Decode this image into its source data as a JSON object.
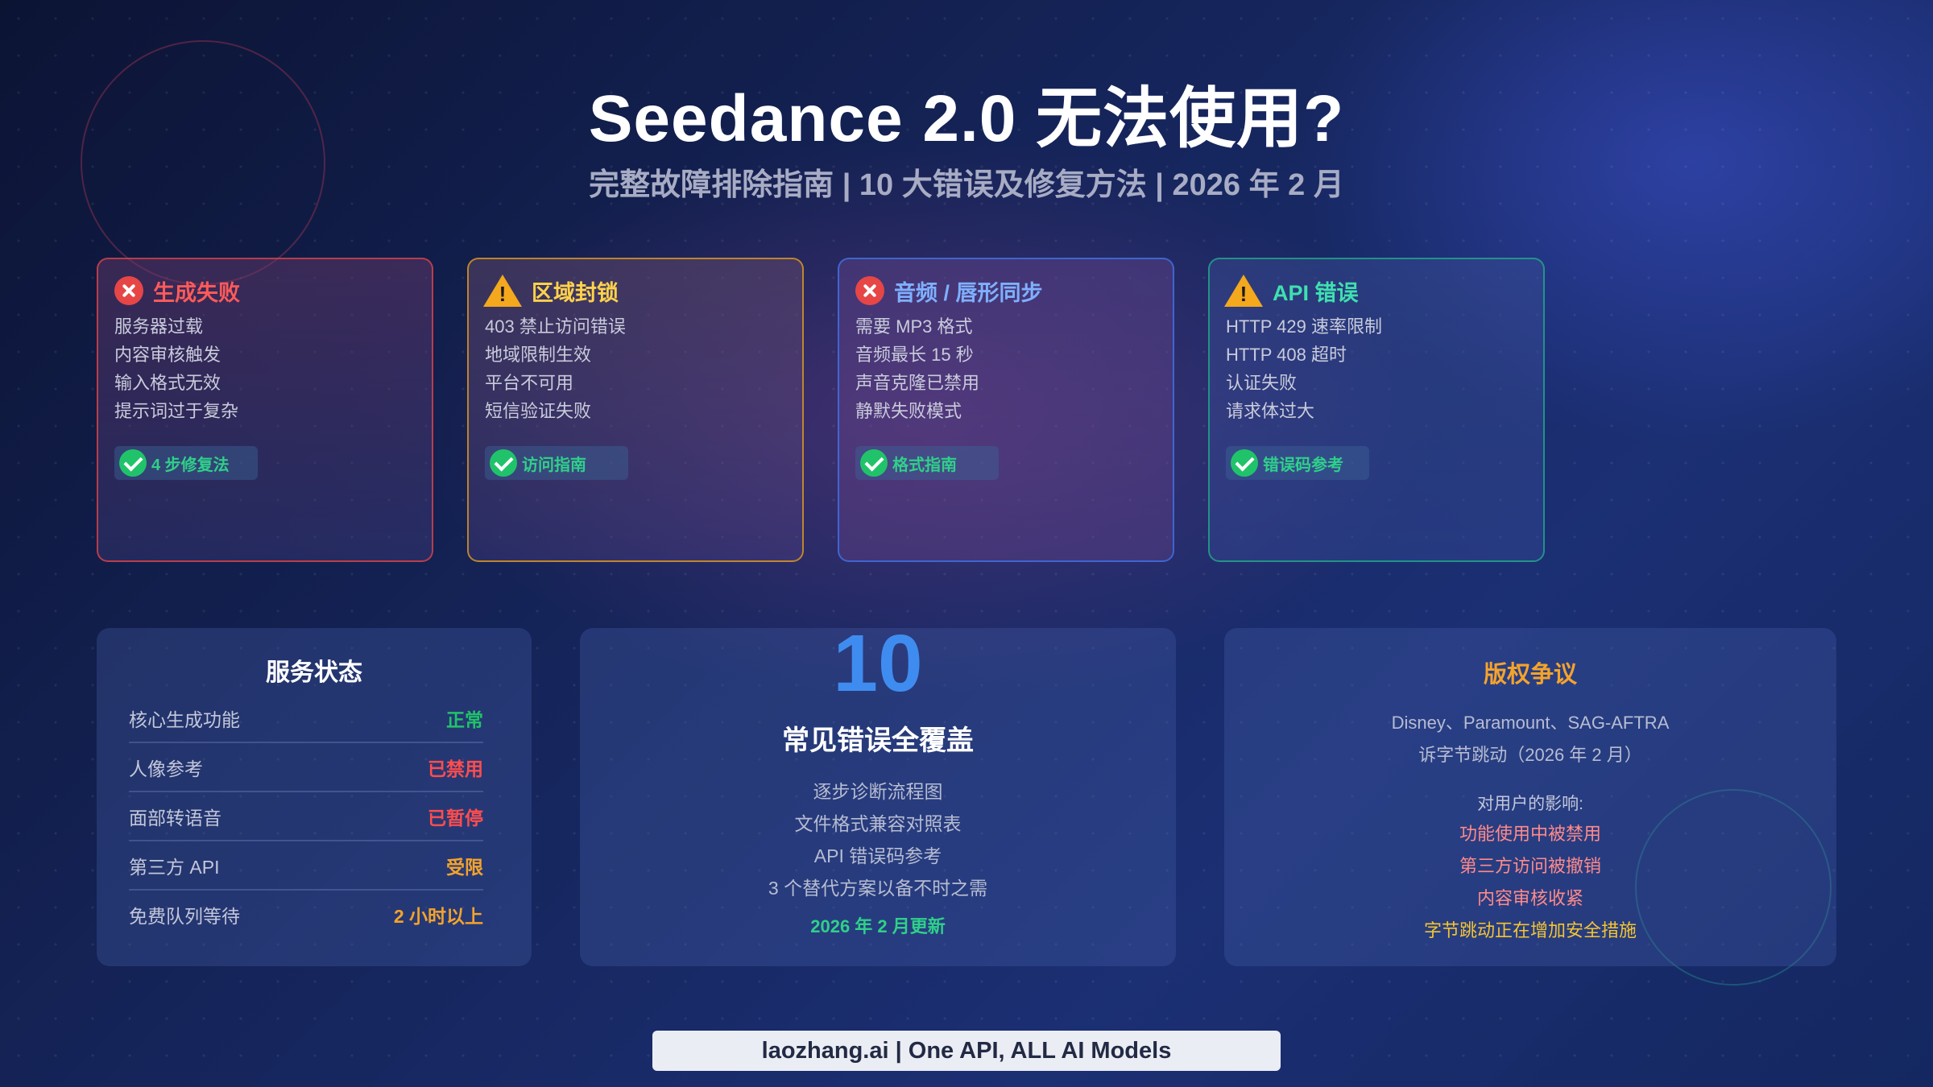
{
  "header": {
    "title": "Seedance 2.0 无法使用?",
    "subtitle": "完整故障排除指南 | 10 大错误及修复方法 | 2026 年 2 月"
  },
  "error_cards": [
    {
      "title": "生成失败",
      "icon": "error-x-icon",
      "accent": "#e64646",
      "title_color": "#ff5a5a",
      "items": [
        "服务器过载",
        "内容审核触发",
        "输入格式无效",
        "提示词过于复杂"
      ],
      "fix_label": "4 步修复法"
    },
    {
      "title": "区域封锁",
      "icon": "warning-icon",
      "accent": "#e09a1f",
      "title_color": "#ffd24a",
      "items": [
        "403 禁止访问错误",
        "地域限制生效",
        "平台不可用",
        "短信验证失败"
      ],
      "fix_label": "访问指南"
    },
    {
      "title": "音频 / 唇形同步",
      "icon": "error-x-icon",
      "accent": "#3f6fe0",
      "title_color": "#7fb0ff",
      "items": [
        "需要 MP3 格式",
        "音频最长 15 秒",
        "声音克隆已禁用",
        "静默失败模式"
      ],
      "fix_label": "格式指南"
    },
    {
      "title": "API 错误",
      "icon": "warning-icon",
      "accent": "#20a98a",
      "title_color": "#3fe0b0",
      "items": [
        "HTTP 429 速率限制",
        "HTTP 408 超时",
        "认证失败",
        "请求体过大"
      ],
      "fix_label": "错误码参考"
    }
  ],
  "service_status": {
    "title": "服务状态",
    "rows": [
      {
        "label": "核心生成功能",
        "value": "正常",
        "color": "#21c36a"
      },
      {
        "label": "人像参考",
        "value": "已禁用",
        "color": "#ff4d4d"
      },
      {
        "label": "面部转语音",
        "value": "已暂停",
        "color": "#ff4d4d"
      },
      {
        "label": "第三方 API",
        "value": "受限",
        "color": "#f4a32b"
      },
      {
        "label": "免费队列等待",
        "value": "2 小时以上",
        "color": "#f4a32b"
      }
    ]
  },
  "summary": {
    "number": "10",
    "title": "常见错误全覆盖",
    "items": [
      "逐步诊断流程图",
      "文件格式兼容对照表",
      "API 错误码参考",
      "3 个替代方案以备不时之需"
    ],
    "updated": "2026 年 2 月更新"
  },
  "copyright": {
    "title": "版权争议",
    "desc": [
      "Disney、Paramount、SAG-AFTRA",
      "诉字节跳动（2026 年 2 月）"
    ],
    "impact_title": "对用户的影响:",
    "impacts": [
      {
        "text": "功能使用中被禁用",
        "color": "#ff8a8a"
      },
      {
        "text": "第三方访问被撤销",
        "color": "#ff8a8a"
      },
      {
        "text": "内容审核收紧",
        "color": "#ff8a8a"
      },
      {
        "text": "字节跳动正在增加安全措施",
        "color": "#f4c430"
      }
    ]
  },
  "footer": {
    "text": "laozhang.ai | One API, ALL AI Models"
  }
}
